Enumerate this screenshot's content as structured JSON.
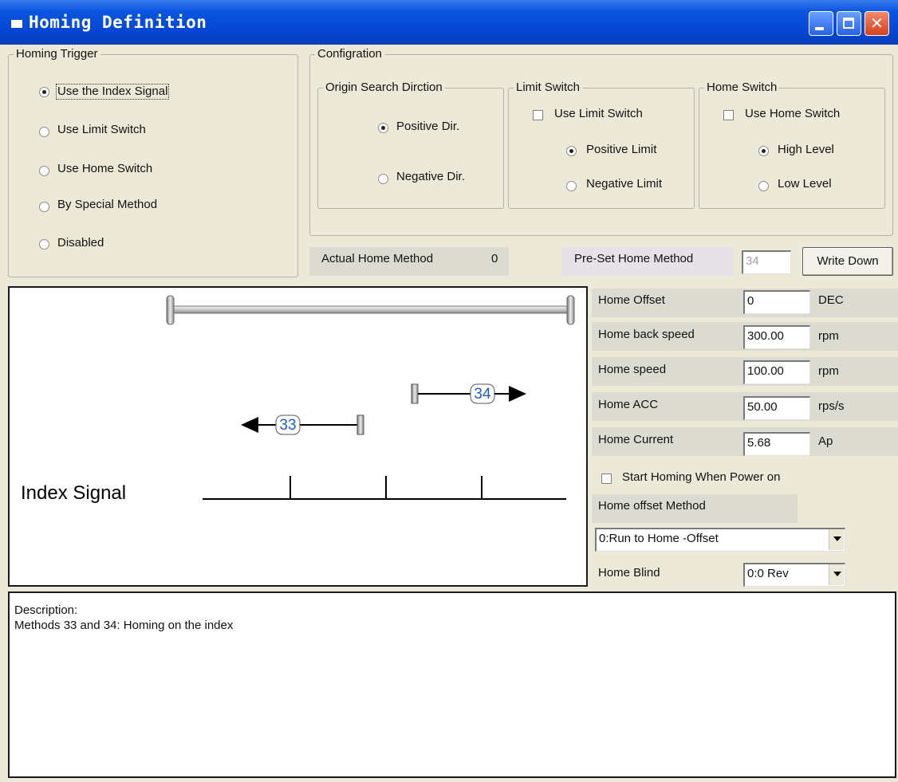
{
  "window": {
    "title": "Homing Definition"
  },
  "homing_trigger": {
    "legend": "Homing Trigger",
    "options": [
      {
        "label": "Use the Index Signal",
        "selected": true
      },
      {
        "label": "Use Limit Switch",
        "selected": false
      },
      {
        "label": "Use Home Switch",
        "selected": false
      },
      {
        "label": "By Special Method",
        "selected": false
      },
      {
        "label": "Disabled",
        "selected": false
      }
    ]
  },
  "configuration": {
    "legend": "Configration",
    "origin_search": {
      "legend": "Origin Search Dirction",
      "positive": "Positive Dir.",
      "negative": "Negative Dir.",
      "selected": "positive"
    },
    "limit_switch": {
      "legend": "Limit Switch",
      "use_label": "Use Limit Switch",
      "use_checked": false,
      "positive": "Positive Limit",
      "negative": "Negative Limit",
      "selected": "positive"
    },
    "home_switch": {
      "legend": "Home Switch",
      "use_label": "Use Home Switch",
      "use_checked": false,
      "high": "High Level",
      "low": "Low Level",
      "selected": "high"
    }
  },
  "method_row": {
    "actual_label": "Actual Home Method",
    "actual_value": "0",
    "preset_label": "Pre-Set Home Method",
    "preset_value": "34",
    "write_button": "Write Down"
  },
  "diagram": {
    "index_label": "Index Signal",
    "method_a": "33",
    "method_b": "34"
  },
  "params": [
    {
      "label": "Home Offset",
      "value": "0",
      "unit": "DEC"
    },
    {
      "label": "Home back speed",
      "value": "300.00",
      "unit": "rpm"
    },
    {
      "label": "Home speed",
      "value": "100.00",
      "unit": "rpm"
    },
    {
      "label": "Home ACC",
      "value": "50.00",
      "unit": "rps/s"
    },
    {
      "label": "Home Current",
      "value": "5.68",
      "unit": "Ap"
    }
  ],
  "start_homing": {
    "label": "Start Homing When Power on",
    "checked": false
  },
  "offset_method": {
    "label": "Home offset Method",
    "selected": "0:Run to Home -Offset"
  },
  "home_blind": {
    "label": "Home Blind",
    "selected": "0:0 Rev"
  },
  "description": {
    "heading": "Description:",
    "text": "Methods 33 and 34: Homing on the index"
  }
}
